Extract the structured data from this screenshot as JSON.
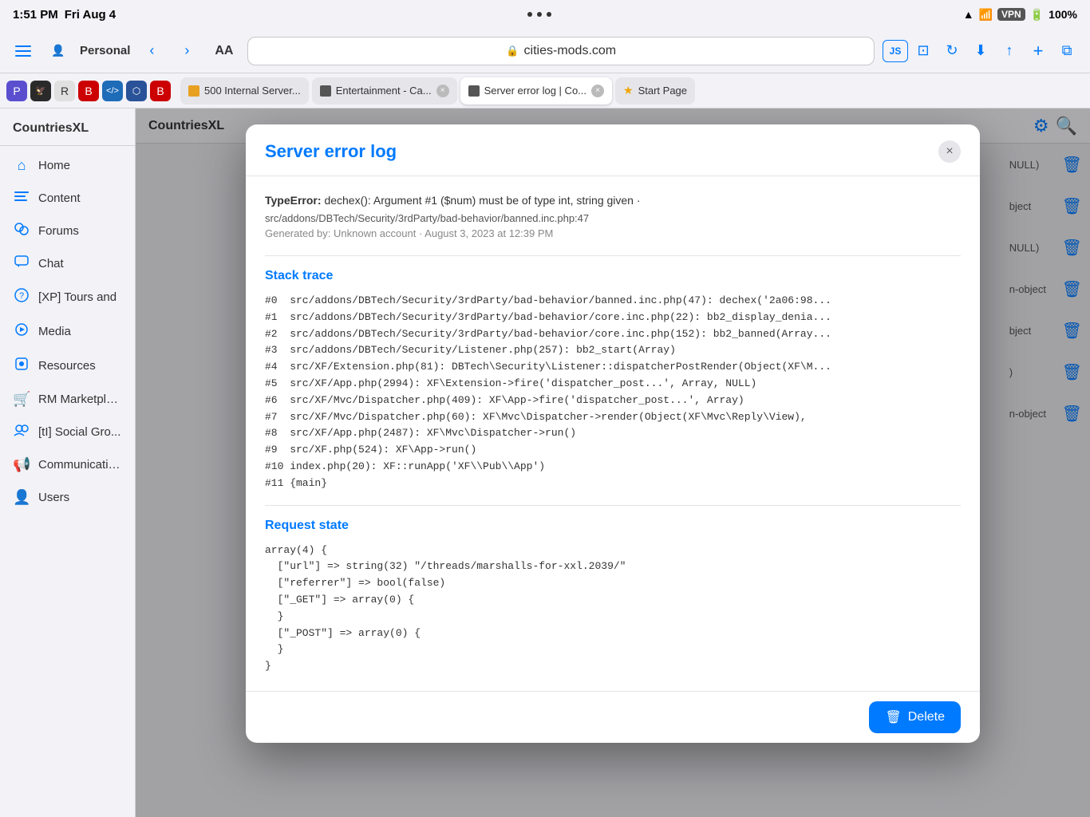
{
  "statusBar": {
    "time": "1:51 PM",
    "day": "Fri Aug 4",
    "dots": [
      "•",
      "•",
      "•"
    ],
    "signal": "▲",
    "wifi": "WiFi",
    "vpn": "VPN",
    "battery": "100%"
  },
  "toolbar": {
    "aa": "AA",
    "url": "cities-mods.com",
    "lock": "🔒"
  },
  "tabs": [
    {
      "id": "tab1",
      "label": "500 Internal Server...",
      "favicon_color": "#e8a020",
      "active": false,
      "closeable": false
    },
    {
      "id": "tab2",
      "label": "Entertainment - Ca...",
      "favicon_color": "#555",
      "active": false,
      "closeable": true
    },
    {
      "id": "tab3",
      "label": "Server error log | Co...",
      "favicon_color": "#555",
      "active": true,
      "closeable": true
    },
    {
      "id": "tab4",
      "label": "Start Page",
      "favicon_color": "#f0a500",
      "active": false,
      "closeable": false,
      "star": true
    }
  ],
  "page": {
    "title": "CountriesXL",
    "settings_icon": "⚙",
    "search_icon": "🔍"
  },
  "sidebar": {
    "items": [
      {
        "id": "home",
        "icon": "⌂",
        "label": "Home"
      },
      {
        "id": "content",
        "icon": "≡",
        "label": "Content"
      },
      {
        "id": "forums",
        "icon": "💬",
        "label": "Forums"
      },
      {
        "id": "chat",
        "icon": "💬",
        "label": "Chat"
      },
      {
        "id": "xp-tours",
        "icon": "❓",
        "label": "[XP] Tours and"
      },
      {
        "id": "media",
        "icon": "⭕",
        "label": "Media"
      },
      {
        "id": "resources",
        "icon": "🛒",
        "label": "Resources"
      },
      {
        "id": "rm-marketplace",
        "icon": "🛒",
        "label": "RM Marketpla..."
      },
      {
        "id": "social-groups",
        "icon": "👥",
        "label": "[tI] Social Gro..."
      },
      {
        "id": "communications",
        "icon": "📢",
        "label": "Communicatio..."
      },
      {
        "id": "users",
        "icon": "👤",
        "label": "Users"
      }
    ]
  },
  "behindContent": {
    "rows": [
      {
        "label": "NULL)",
        "hasTrash": true
      },
      {
        "label": "bject",
        "hasTrash": true
      },
      {
        "label": "NULL)",
        "hasTrash": true
      },
      {
        "label": "n-object",
        "hasTrash": true
      },
      {
        "label": "bject",
        "hasTrash": true
      },
      {
        "label": ")",
        "hasTrash": true
      },
      {
        "label": "n-object",
        "hasTrash": true
      }
    ]
  },
  "modal": {
    "title": "Server error log",
    "close_label": "×",
    "error": {
      "type": "TypeError:",
      "message": "dechex(): Argument #1 ($num) must be of type int, string given ·",
      "path": "src/addons/DBTech/Security/3rdParty/bad-behavior/banned.inc.php:47",
      "generated": "Generated by: Unknown account · August 3, 2023 at 12:39 PM"
    },
    "stackTrace": {
      "sectionTitle": "Stack trace",
      "lines": [
        "#0  src/addons/DBTech/Security/3rdParty/bad-behavior/banned.inc.php(47): dechex('2a06:98...",
        "#1  src/addons/DBTech/Security/3rdParty/bad-behavior/core.inc.php(22): bb2_display_denia...",
        "#2  src/addons/DBTech/Security/3rdParty/bad-behavior/core.inc.php(152): bb2_banned(Array...",
        "#3  src/addons/DBTech/Security/Listener.php(257): bb2_start(Array)",
        "#4  src/XF/Extension.php(81): DBTech\\Security\\Listener::dispatcherPostRender(Object(XF\\M...",
        "#5  src/XF/App.php(2994): XF\\Extension->fire('dispatcher_post...', Array, NULL)",
        "#6  src/XF/Mvc/Dispatcher.php(409): XF\\App->fire('dispatcher_post...', Array)",
        "#7  src/XF/Mvc/Dispatcher.php(60): XF\\Mvc\\Dispatcher->render(Object(XF\\Mvc\\Reply\\View),",
        "#8  src/XF/App.php(2487): XF\\Mvc\\Dispatcher->run()",
        "#9  src/XF.php(524): XF\\App->run()",
        "#10 index.php(20): XF::runApp('XF\\\\Pub\\\\App')",
        "#11 {main}"
      ]
    },
    "requestState": {
      "sectionTitle": "Request state",
      "content": "array(4) {\n  [\"url\"] => string(32) \"/threads/marshalls-for-xxl.2039/\"\n  [\"referrer\"] => bool(false)\n  [\"_GET\"] => array(0) {\n  }\n  [\"_POST\"] => array(0) {\n  }\n}"
    },
    "footer": {
      "delete_label": "Delete",
      "delete_icon": "🗑"
    }
  }
}
